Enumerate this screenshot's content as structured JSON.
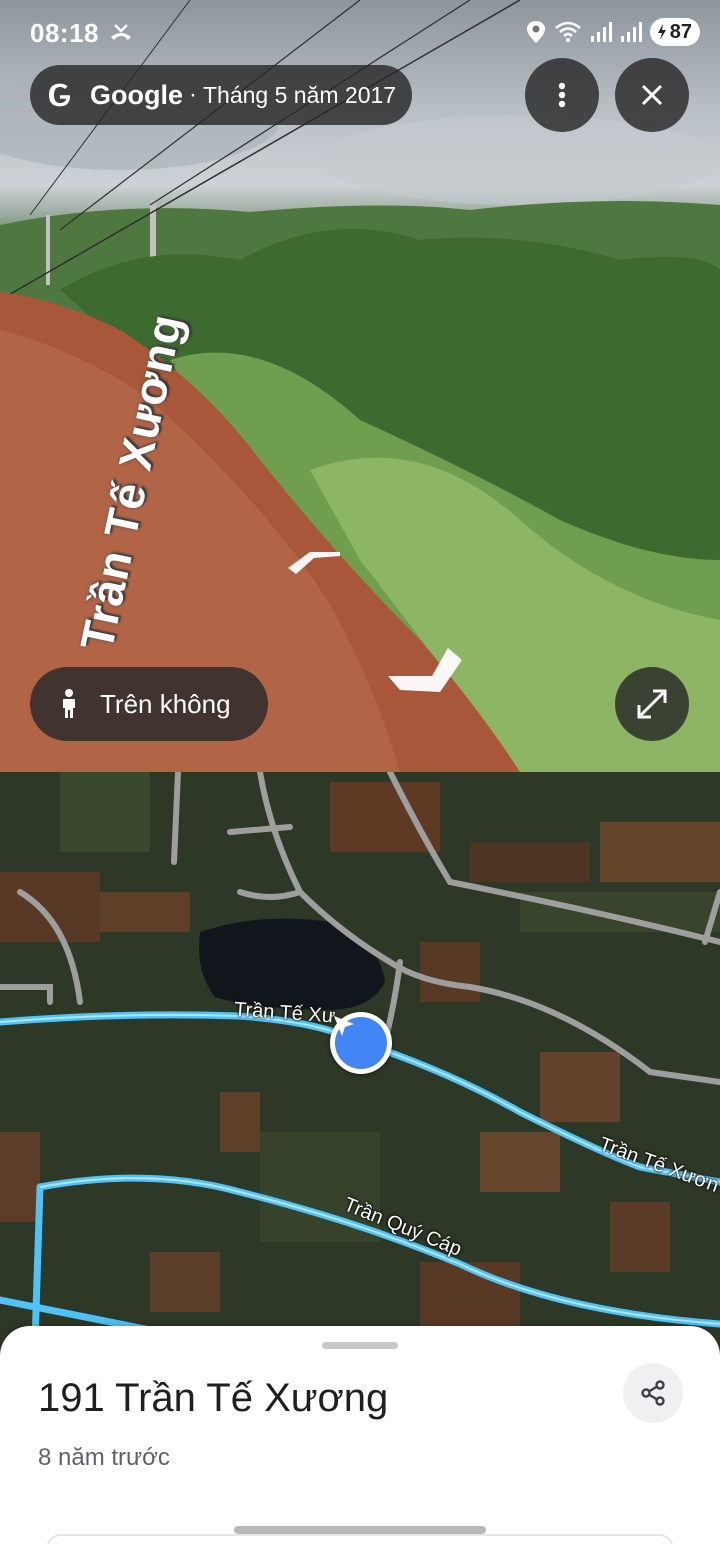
{
  "status_bar": {
    "time": "08:18",
    "battery": "87",
    "icons": [
      "missed-call-icon",
      "location-icon",
      "wifi-icon",
      "signal-icon",
      "signal-icon",
      "battery-icon"
    ]
  },
  "street_view": {
    "source_brand": "Google",
    "separator": "·",
    "capture_date": "Tháng 5 năm 2017",
    "road_label": "Trần Tế Xương",
    "aerial_button_label": "Trên không",
    "icons": [
      "google-g-icon",
      "more-vert-icon",
      "close-icon",
      "person-icon",
      "expand-icon",
      "navigate-arrow-icon"
    ]
  },
  "map": {
    "labels": [
      "Trần Tế Xư",
      "Trần Tế Xươn",
      "Trần Quý Cáp"
    ],
    "route_color": "#4fc3f7",
    "road_color": "#9e9e9e",
    "icons": [
      "navigation-arrow-icon"
    ]
  },
  "place_sheet": {
    "title": "191 Trần Tế Xương",
    "subtitle": "8 năm trước",
    "icons": [
      "share-icon"
    ]
  },
  "colors": {
    "accent": "#4285f4",
    "chip_bg": "#282828",
    "sheet_bg": "#ffffff"
  }
}
